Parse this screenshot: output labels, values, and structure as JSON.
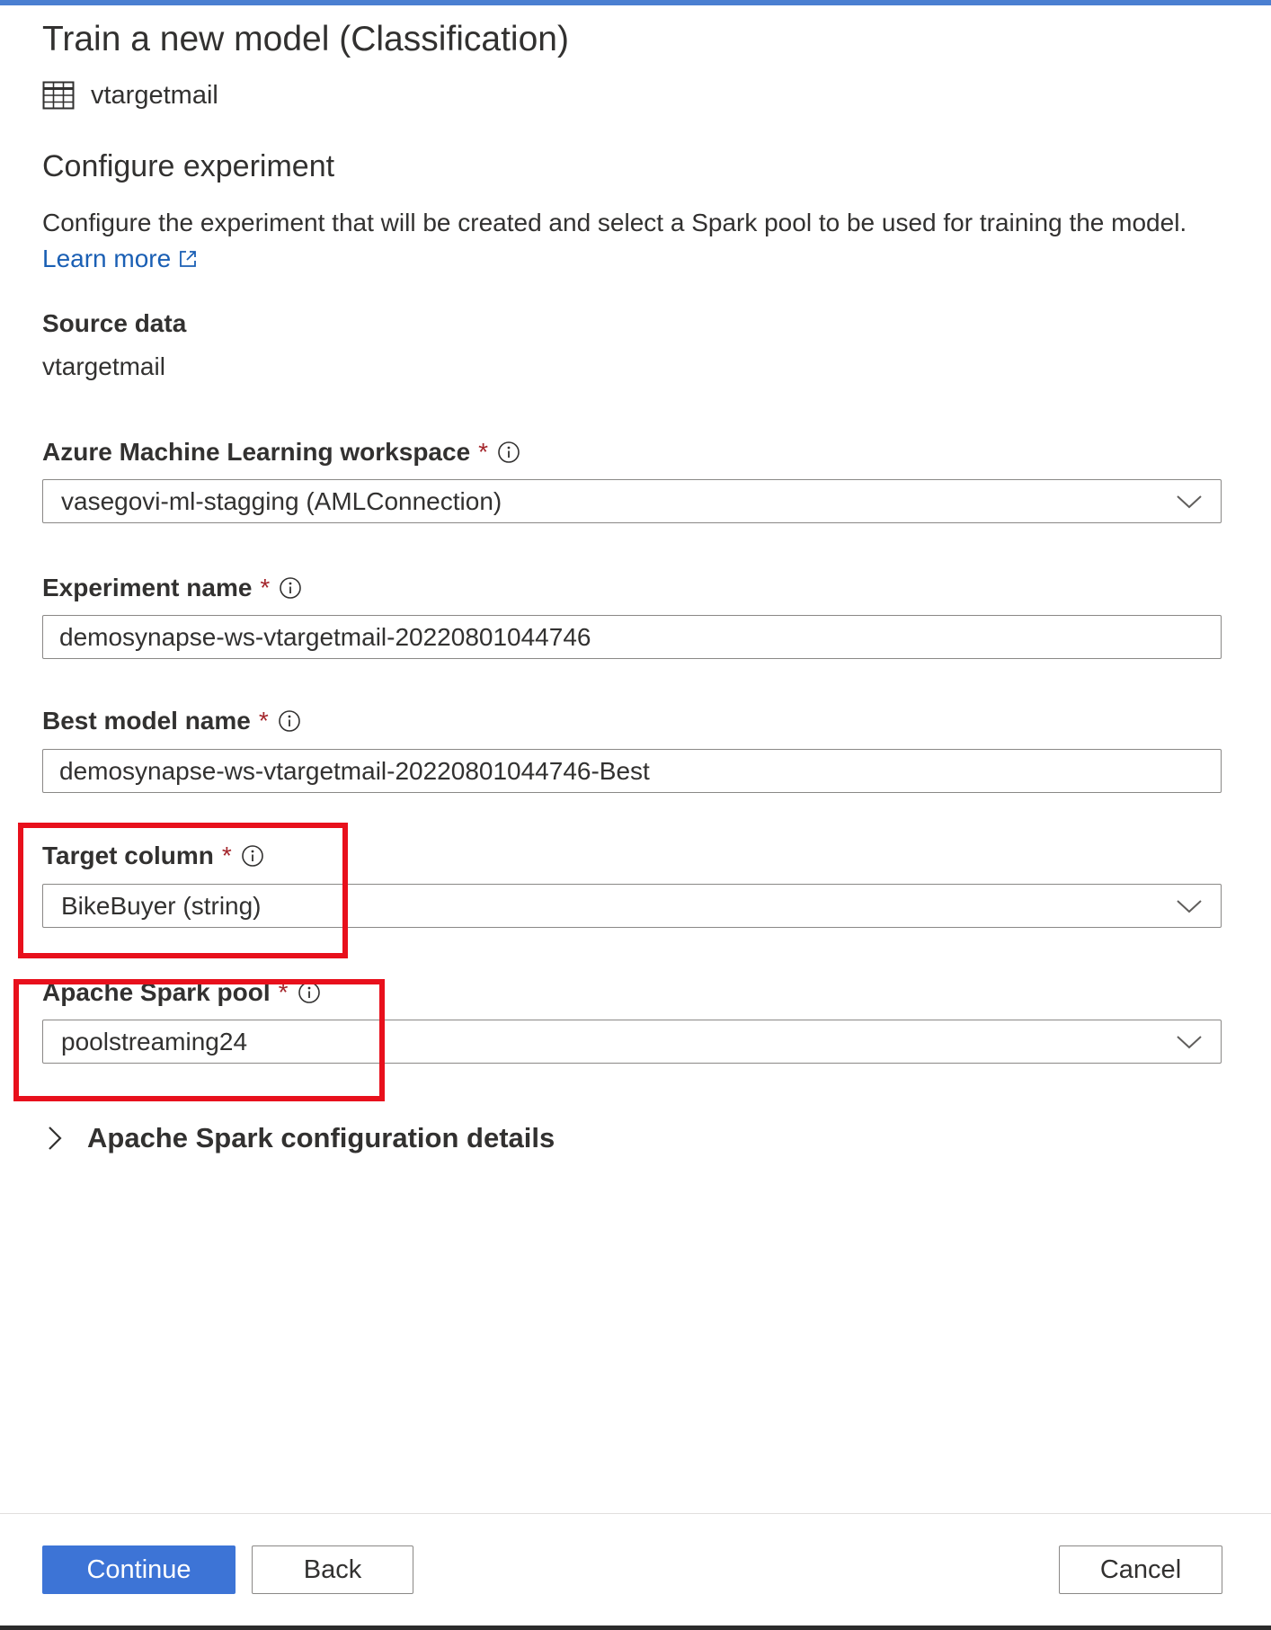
{
  "header": {
    "title": "Train a new model (Classification)",
    "source_table": "vtargetmail"
  },
  "section": {
    "title": "Configure experiment",
    "description": "Configure the experiment that will be created and select a Spark pool to be used for training the model.",
    "learn_more": "Learn more"
  },
  "source_data": {
    "label": "Source data",
    "value": "vtargetmail"
  },
  "fields": {
    "workspace": {
      "label": "Azure Machine Learning workspace",
      "required": "*",
      "value": "vasegovi-ml-stagging (AMLConnection)"
    },
    "experiment_name": {
      "label": "Experiment name",
      "required": "*",
      "value": "demosynapse-ws-vtargetmail-20220801044746"
    },
    "best_model_name": {
      "label": "Best model name",
      "required": "*",
      "value": "demosynapse-ws-vtargetmail-20220801044746-Best"
    },
    "target_column": {
      "label": "Target column",
      "required": "*",
      "value": "BikeBuyer (string)"
    },
    "spark_pool": {
      "label": "Apache Spark pool",
      "required": "*",
      "value": "poolstreaming24"
    }
  },
  "expander": {
    "label": "Apache Spark configuration details"
  },
  "footer": {
    "continue_label": "Continue",
    "back_label": "Back",
    "cancel_label": "Cancel"
  },
  "colors": {
    "accent": "#4a7fd1",
    "primary_button": "#3d74d6",
    "link": "#1a5fb4",
    "required_star": "#a4262c",
    "highlight": "#e8101c"
  },
  "icons": {
    "table": "table-icon",
    "external_link": "external-link-icon",
    "info": "info-icon",
    "dropdown": "chevron-down-icon",
    "expander": "chevron-right-icon"
  }
}
